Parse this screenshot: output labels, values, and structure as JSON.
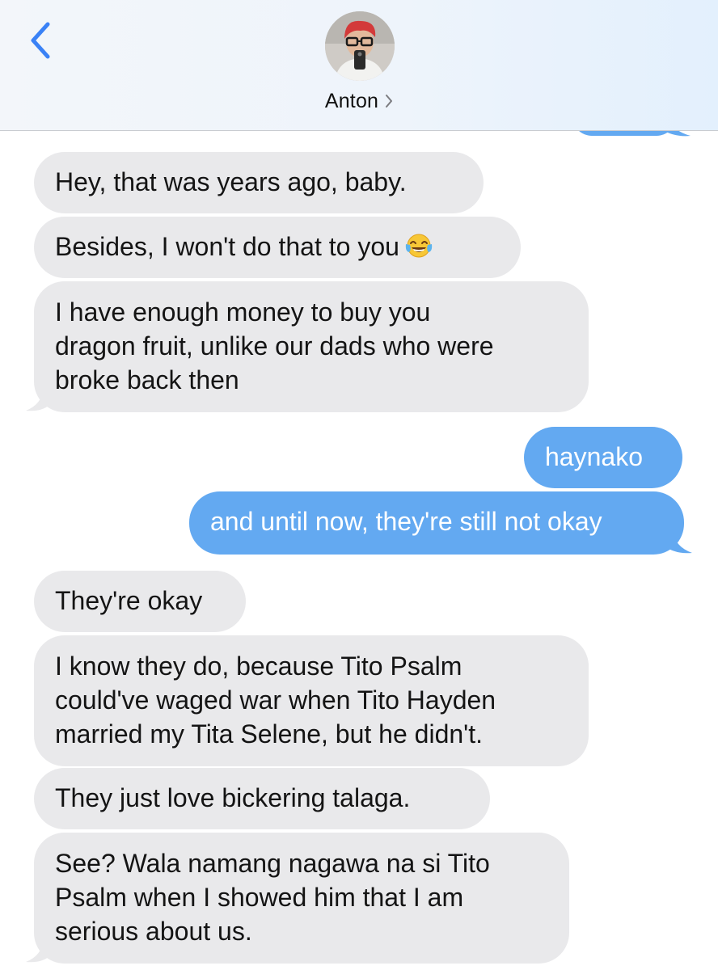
{
  "header": {
    "back_label": "Back",
    "contact_name": "Anton"
  },
  "colors": {
    "incoming_bubble": "#e9e9eb",
    "outgoing_bubble": "#63a9f1",
    "ios_blue": "#3a82f6"
  },
  "icons": {
    "back": "chevron-left-icon",
    "contact_detail": "chevron-right-icon",
    "laugh": "face-with-tears-of-joy-icon"
  },
  "messages": [
    {
      "direction": "incoming",
      "lines": [
        "Hey, that was years ago, baby."
      ]
    },
    {
      "direction": "incoming",
      "lines": [
        "Besides, I won't do that to you"
      ],
      "emoji": "😂"
    },
    {
      "direction": "incoming",
      "lines": [
        "I have enough money to buy you",
        "dragon fruit, unlike our dads who were",
        "broke back then"
      ]
    },
    {
      "direction": "outgoing",
      "lines": [
        "haynako"
      ]
    },
    {
      "direction": "outgoing",
      "lines": [
        "and until now, they're still not okay"
      ]
    },
    {
      "direction": "incoming",
      "lines": [
        "They're okay"
      ]
    },
    {
      "direction": "incoming",
      "lines": [
        "I know they do, because Tito Psalm",
        "could've waged war when Tito Hayden",
        "married my Tita Selene, but he didn't."
      ]
    },
    {
      "direction": "incoming",
      "lines": [
        "They just love bickering talaga."
      ]
    },
    {
      "direction": "incoming",
      "lines": [
        "See? Wala namang nagawa na si Tito",
        "Psalm when I showed him that I am",
        "serious about us."
      ]
    }
  ]
}
